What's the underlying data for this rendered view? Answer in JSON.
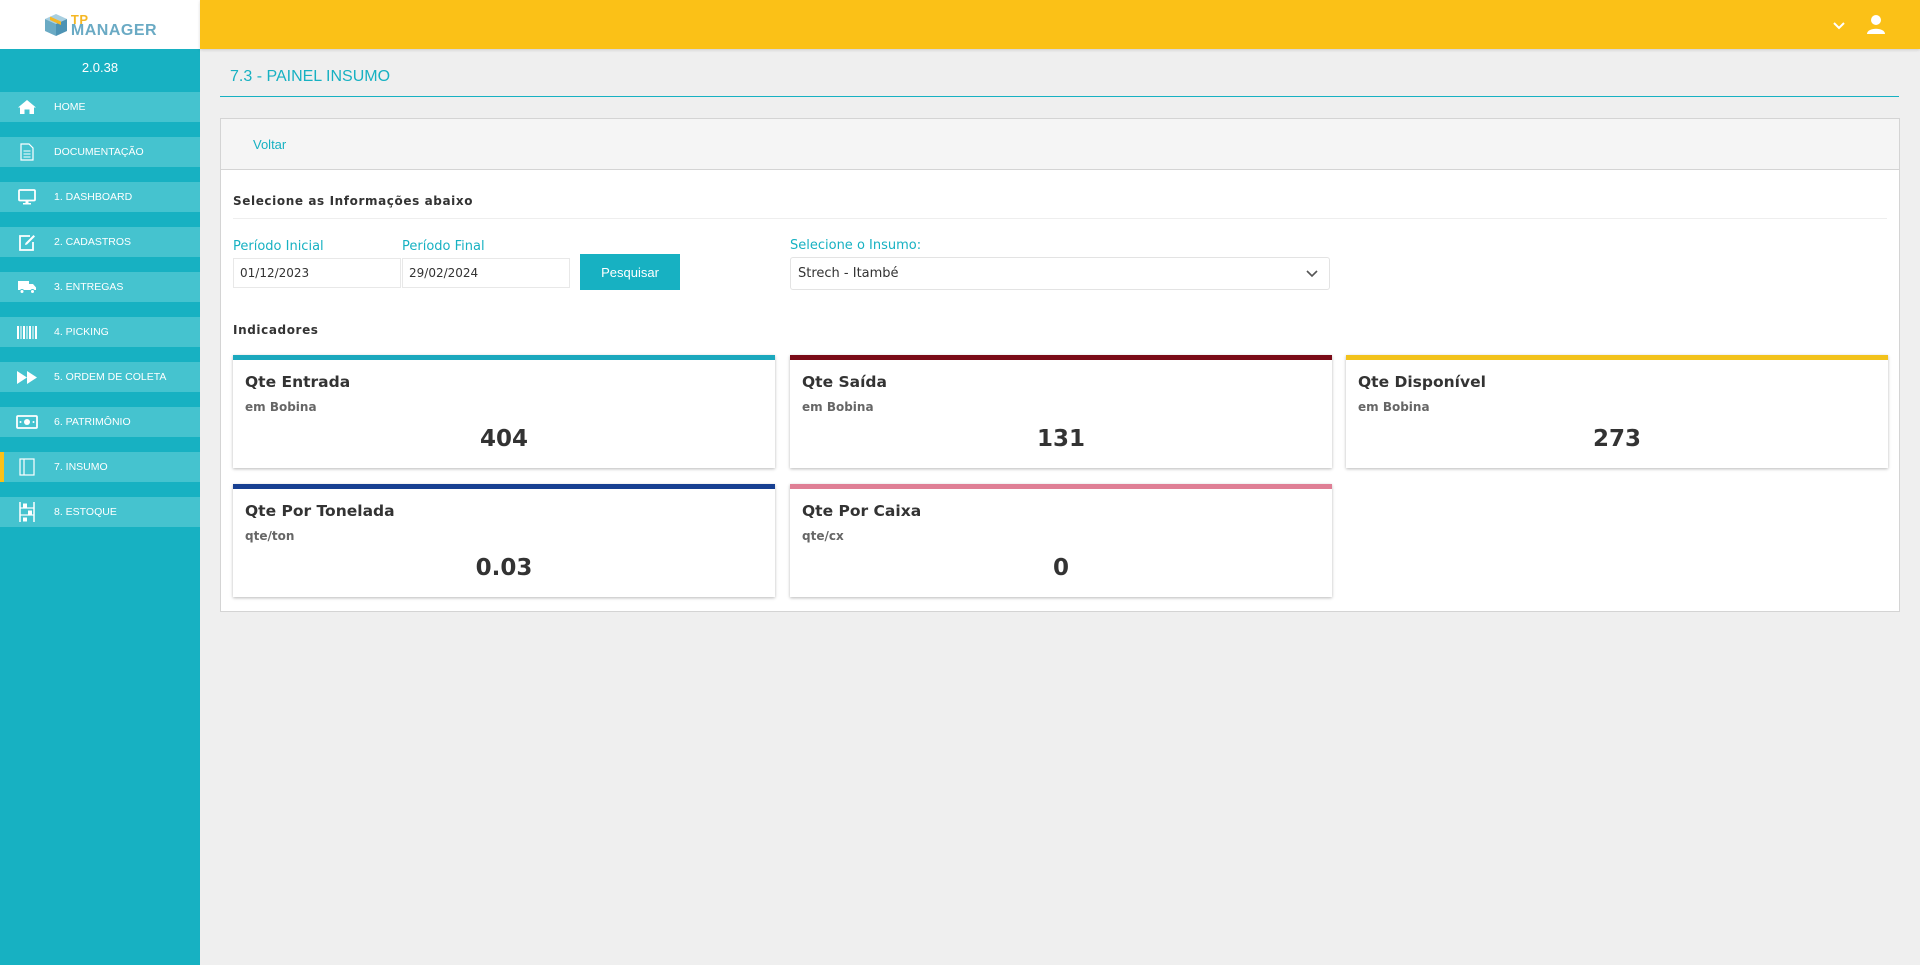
{
  "app": {
    "logo_top": "TP",
    "logo_bottom": "MANAGER",
    "version": "2.0.38"
  },
  "sidebar": {
    "items": [
      {
        "label": "HOME",
        "icon": "home-icon"
      },
      {
        "label": "DOCUMENTAÇÃO",
        "icon": "document-icon"
      },
      {
        "label": "1. DASHBOARD",
        "icon": "monitor-icon"
      },
      {
        "label": "2. CADASTROS",
        "icon": "edit-icon"
      },
      {
        "label": "3. ENTREGAS",
        "icon": "truck-icon"
      },
      {
        "label": "4. PICKING",
        "icon": "barcode-icon"
      },
      {
        "label": "5. ORDEM DE COLETA",
        "icon": "fast-forward-icon"
      },
      {
        "label": "6. PATRIMÔNIO",
        "icon": "money-icon"
      },
      {
        "label": "7. INSUMO",
        "icon": "book-icon",
        "active": true
      },
      {
        "label": "8. ESTOQUE",
        "icon": "shelves-icon"
      }
    ],
    "active_color": "#fbc117"
  },
  "topbar": {
    "color": "#fbc117",
    "icons": [
      "chevron-down-icon",
      "user-icon"
    ]
  },
  "page": {
    "title": "7.3 - PAINEL INSUMO",
    "back_label": "Voltar",
    "filters_title": "Selecione as Informações abaixo",
    "start_label": "Período Inicial",
    "start_value": "01/12/2023",
    "end_label": "Período Final",
    "end_value": "29/02/2024",
    "search_label": "Pesquisar",
    "insumo_label": "Selecione o Insumo:",
    "insumo_value": "Strech - Itambé",
    "indicators_title": "Indicadores"
  },
  "cards": [
    {
      "title": "Qte Entrada",
      "subtitle": "em Bobina",
      "value": "404",
      "color": "#1ba8bd"
    },
    {
      "title": "Qte Saída",
      "subtitle": "em Bobina",
      "value": "131",
      "color": "#7a0b17"
    },
    {
      "title": "Qte Disponível",
      "subtitle": "em Bobina",
      "value": "273",
      "color": "#f2c21b"
    },
    {
      "title": "Qte Por Tonelada",
      "subtitle": "qte/ton",
      "value": "0.03",
      "color": "#173f91"
    },
    {
      "title": "Qte Por Caixa",
      "subtitle": "qte/cx",
      "value": "0",
      "color": "#df7f95"
    }
  ],
  "colors": {
    "primary": "#17b1c2",
    "sidebar": "#17b1c2",
    "sidebar_item": "#45c3cf"
  }
}
